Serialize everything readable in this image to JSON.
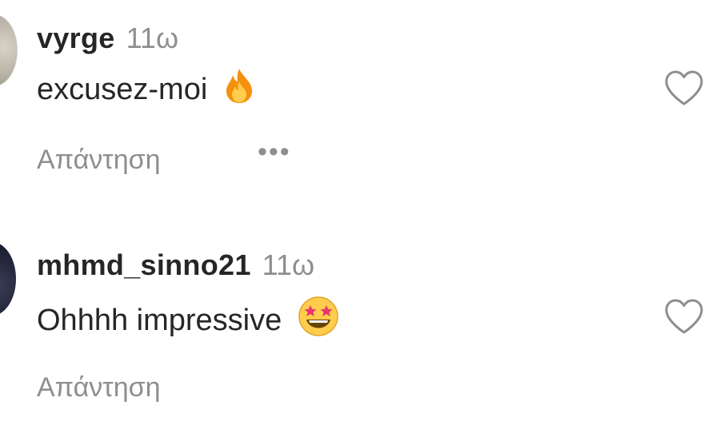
{
  "comments": [
    {
      "username": "vyrge",
      "time": "11ω",
      "text": "excusez-moi",
      "emoji": "fire-emoji",
      "reply_label": "Απάντηση",
      "more_label": "•••",
      "liked": false
    },
    {
      "username": "mhmd_sinno21",
      "time": "11ω",
      "text": "Ohhhh impressive",
      "emoji": "star-struck-emoji",
      "reply_label": "Απάντηση",
      "liked": false
    }
  ],
  "colors": {
    "primary_text": "#262626",
    "secondary_text": "#8e8e8e",
    "background": "#ffffff"
  }
}
